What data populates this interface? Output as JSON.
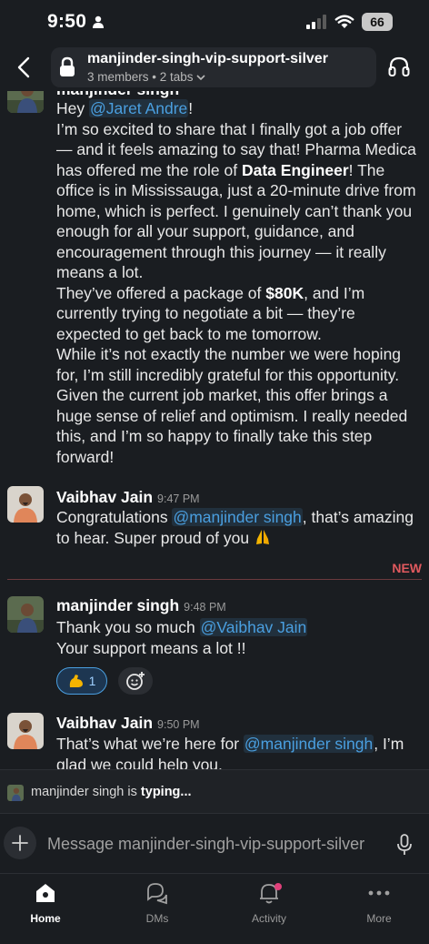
{
  "status_bar": {
    "time": "9:50",
    "battery": "66"
  },
  "header": {
    "channel_name": "manjinder-singh-vip-support-silver",
    "meta": "3 members • 2 tabs"
  },
  "messages": [
    {
      "sender": "manjinder singh",
      "greeting": "Hey",
      "mention": "@Jaret Andre",
      "after_mention": "!",
      "p1_a": "I’m so excited to share that I finally got a job offer — and it feels amazing to say that! Pharma Medica has offered me the role of",
      "p1_bold": "Data Engineer",
      "p1_b": "! The office is in Mississauga, just a 20-minute drive from home, which is perfect. I genuinely can’t thank you enough for all your support, guidance, and encouragement through this journey — it really means a lot.",
      "p2_a": "They’ve offered a package of",
      "p2_bold": "$80K",
      "p2_b": ", and I’m currently trying to negotiate a bit — they’re expected to get back to me tomorrow.",
      "p3": "While it’s not exactly the number we were hoping for, I’m still incredibly grateful for this opportunity. Given the current job market, this offer brings a huge sense of relief and optimism. I really needed this, and I’m so happy to finally take this step forward!"
    },
    {
      "sender": "Vaibhav Jain",
      "time": "9:47 PM",
      "text_a": "Congratulations",
      "mention": "@manjinder singh",
      "text_b": ", that’s amazing to hear. Super proud of you"
    },
    {
      "sender": "manjinder singh",
      "time": "9:48 PM",
      "text_a": "Thank you so much",
      "mention": "@Vaibhav Jain",
      "text_b": "Your support means a lot !!",
      "reaction_count": "1"
    },
    {
      "sender": "Vaibhav Jain",
      "time": "9:50 PM",
      "text_a": "That’s what we’re here for",
      "mention": "@manjinder singh",
      "text_b": ", I’m glad we could help you."
    }
  ],
  "new_label": "NEW",
  "typing": {
    "name": "manjinder singh",
    "suffix": "is",
    "action": "typing..."
  },
  "composer": {
    "placeholder": "Message manjinder-singh-vip-support-silver"
  },
  "nav": {
    "home": "Home",
    "dms": "DMs",
    "activity": "Activity",
    "more": "More"
  },
  "colors": {
    "background": "#1a1d21",
    "mention": "#4a9fe0",
    "new": "#e0595e"
  }
}
